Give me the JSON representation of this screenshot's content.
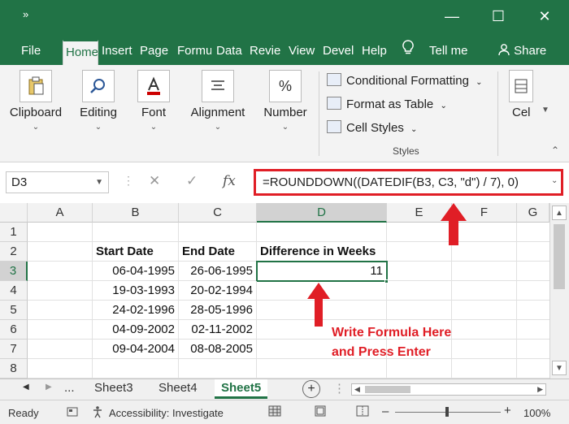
{
  "titlebar": {
    "qat_icon": "»",
    "min_icon": "—",
    "max_icon": "☐",
    "close_icon": "✕"
  },
  "tabs": [
    {
      "label": "File"
    },
    {
      "label": "Home"
    },
    {
      "label": "Insert"
    },
    {
      "label": "Page L"
    },
    {
      "label": "Formu"
    },
    {
      "label": "Data"
    },
    {
      "label": "Revie"
    },
    {
      "label": "View"
    },
    {
      "label": "Devel"
    },
    {
      "label": "Help"
    },
    {
      "label": "Tell me"
    },
    {
      "label": "Share"
    }
  ],
  "ribbon": {
    "clipboard": "Clipboard",
    "editing": "Editing",
    "font": "Font",
    "alignment": "Alignment",
    "number": "Number",
    "number_icon": "%",
    "cond_format": "Conditional Formatting",
    "format_table": "Format as Table",
    "cell_styles": "Cell Styles",
    "styles_group": "Styles",
    "cells": "Cel"
  },
  "formula_bar": {
    "name_box": "D3",
    "fx": "fx",
    "formula": "=ROUNDDOWN((DATEDIF(B3, C3, \"d\") / 7), 0)"
  },
  "grid": {
    "columns": [
      "A",
      "B",
      "C",
      "D",
      "E",
      "F",
      "G"
    ],
    "rows": [
      "1",
      "2",
      "3",
      "4",
      "5",
      "6",
      "7",
      "8"
    ],
    "header_row": {
      "b": "Start Date",
      "c": "End Date",
      "d": "Difference in Weeks"
    },
    "data": [
      {
        "b": "06-04-1995",
        "c": "26-06-1995",
        "d": "11"
      },
      {
        "b": "19-03-1993",
        "c": "20-02-1994",
        "d": ""
      },
      {
        "b": "24-02-1996",
        "c": "28-05-1996",
        "d": ""
      },
      {
        "b": "04-09-2002",
        "c": "02-11-2002",
        "d": ""
      },
      {
        "b": "09-04-2004",
        "c": "08-08-2005",
        "d": ""
      }
    ]
  },
  "annotation": {
    "line1": "Write Formula Here",
    "line2": "and Press Enter"
  },
  "sheets": {
    "more": "...",
    "tabs": [
      "Sheet3",
      "Sheet4",
      "Sheet5"
    ],
    "active": "Sheet5"
  },
  "status": {
    "ready": "Ready",
    "accessibility": "Accessibility: Investigate",
    "zoom": "100%"
  },
  "colors": {
    "excel_green": "#217346",
    "annotation_red": "#e01e26"
  }
}
